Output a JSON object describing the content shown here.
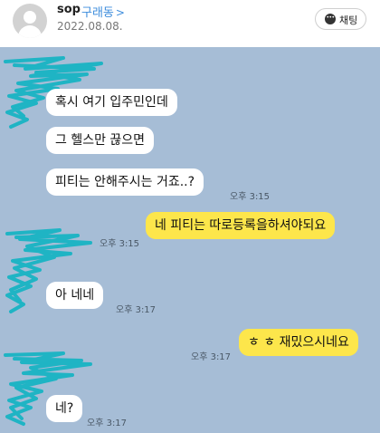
{
  "header": {
    "username": "sop",
    "location": "구래동",
    "location_chevron": ">",
    "date": "2022.08.08.",
    "chat_button_label": "채팅",
    "chat_icon": "chat-bubble-icon"
  },
  "colors": {
    "chat_background": "#a6bdd6",
    "outgoing_bubble": "#fde64b",
    "incoming_bubble": "#ffffff",
    "redaction_scribble": "#1fb4c4",
    "location_link": "#3c8cdc"
  },
  "messages": [
    {
      "direction": "incoming",
      "text": "혹시 여기 입주민인데",
      "time": ""
    },
    {
      "direction": "incoming",
      "text": "그 헬스만 끊으면",
      "time": ""
    },
    {
      "direction": "incoming",
      "text": "피티는 안해주시는 거죠..?",
      "time": "오후 3:15"
    },
    {
      "direction": "outgoing",
      "text": "네  피티는 따로등록을하셔야되요",
      "time": "오후 3:15"
    },
    {
      "direction": "incoming",
      "text": "아 네네",
      "time": "오후 3:17"
    },
    {
      "direction": "outgoing",
      "text": "ㅎ ㅎ 재밌으시네요",
      "time": "오후 3:17"
    },
    {
      "direction": "incoming",
      "text": "네?",
      "time": "오후 3:17"
    }
  ]
}
